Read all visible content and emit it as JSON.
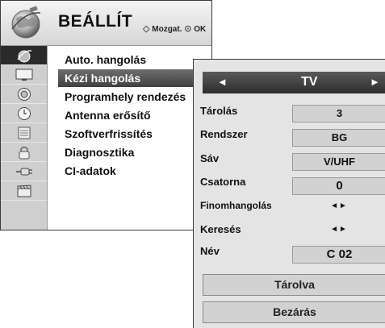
{
  "header": {
    "title": "BEÁLLÍT",
    "hint_move": "Mozgat.",
    "hint_ok": "OK",
    "icon": "globe-satellite-icon"
  },
  "sidebar": {
    "icons": [
      "satellite-icon",
      "picture-icon",
      "audio-icon",
      "clock-icon",
      "options-icon",
      "lock-icon",
      "input-cable-icon",
      "usb-movie-icon"
    ]
  },
  "menu": {
    "items": [
      {
        "label": "Auto. hangolás"
      },
      {
        "label": "Kézi hangolás",
        "selected": true
      },
      {
        "label": "Programhely rendezés"
      },
      {
        "label": "Antenna erősítő"
      },
      {
        "label": "Szoftverfrissítés"
      },
      {
        "label": "Diagnosztika"
      },
      {
        "label": "CI-adatok"
      }
    ]
  },
  "manual_tuning": {
    "source_selector": {
      "value": "TV",
      "left_arrow": "◄",
      "right_arrow": "►"
    },
    "storage": {
      "label": "Tárolás",
      "value": "3"
    },
    "system": {
      "label": "Rendszer",
      "value": "BG"
    },
    "band": {
      "label": "Sáv",
      "value": "V/UHF"
    },
    "channel": {
      "label": "Csatorna",
      "value": "0"
    },
    "fine_tune": {
      "label": "Finomhangolás",
      "arrows": "◄►"
    },
    "search": {
      "label": "Keresés",
      "arrows": "◄►"
    },
    "name": {
      "label": "Név",
      "value": "C 02"
    },
    "store_button": "Tárolva",
    "close_button": "Bezárás"
  },
  "colors": {
    "selected_bg": "#4a4a4a",
    "panel_bg": "#e4e4e4",
    "sidebar_bg": "#cfcfcf"
  }
}
